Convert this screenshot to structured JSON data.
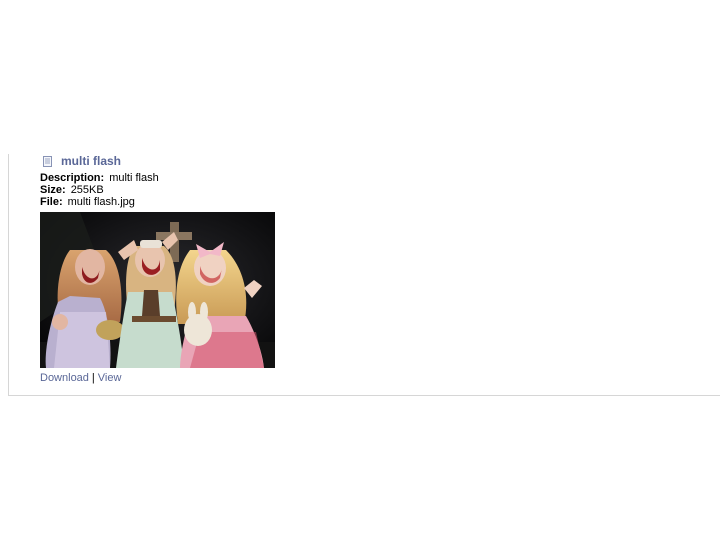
{
  "attachment": {
    "title": "multi flash",
    "icon": "document-icon",
    "description_label": "Description:",
    "description_value": "multi flash",
    "size_label": "Size:",
    "size_value": "255KB",
    "file_label": "File:",
    "file_value": "multi flash.jpg",
    "actions": {
      "download_label": "Download",
      "separator": "|",
      "view_label": "View"
    }
  },
  "colors": {
    "link": "#5a6797",
    "border": "#d6d6d6",
    "background": "#ffffff"
  }
}
